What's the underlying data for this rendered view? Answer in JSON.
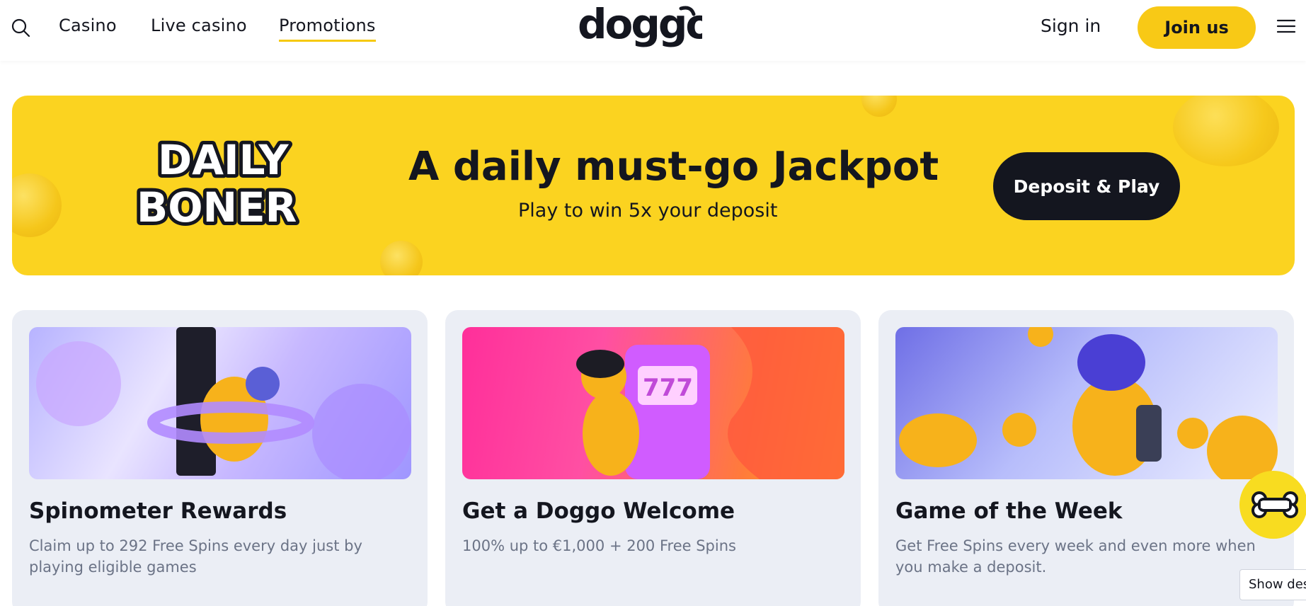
{
  "header": {
    "nav": [
      {
        "label": "Casino"
      },
      {
        "label": "Live casino"
      },
      {
        "label": "Promotions"
      }
    ],
    "logo_text": "doggo",
    "sign_in_label": "Sign in",
    "join_label": "Join us",
    "active_tab": "Promotions"
  },
  "banner": {
    "logo_text": "DAILY BONER",
    "title": "A daily must-go Jackpot",
    "subtitle": "Play to win 5x your deposit",
    "cta_label": "Deposit & Play"
  },
  "promotions": [
    {
      "title": "Spinometer Rewards",
      "description": "Claim up to 292 Free Spins every day just by playing eligible games"
    },
    {
      "title": "Get a Doggo Welcome",
      "description": "100% up to €1,000 + 200 Free Spins"
    },
    {
      "title": "Game of the Week",
      "description": "Get Free Spins every week and even more when you make a deposit."
    }
  ],
  "desktop_toggle_label": "Show desk",
  "colors": {
    "brand_yellow": "#fbd320",
    "dark": "#14161f",
    "card_bg": "#ebeef5",
    "muted_text": "#6b7386"
  },
  "icons": [
    "search-icon",
    "hamburger-menu-icon",
    "bone-icon"
  ]
}
